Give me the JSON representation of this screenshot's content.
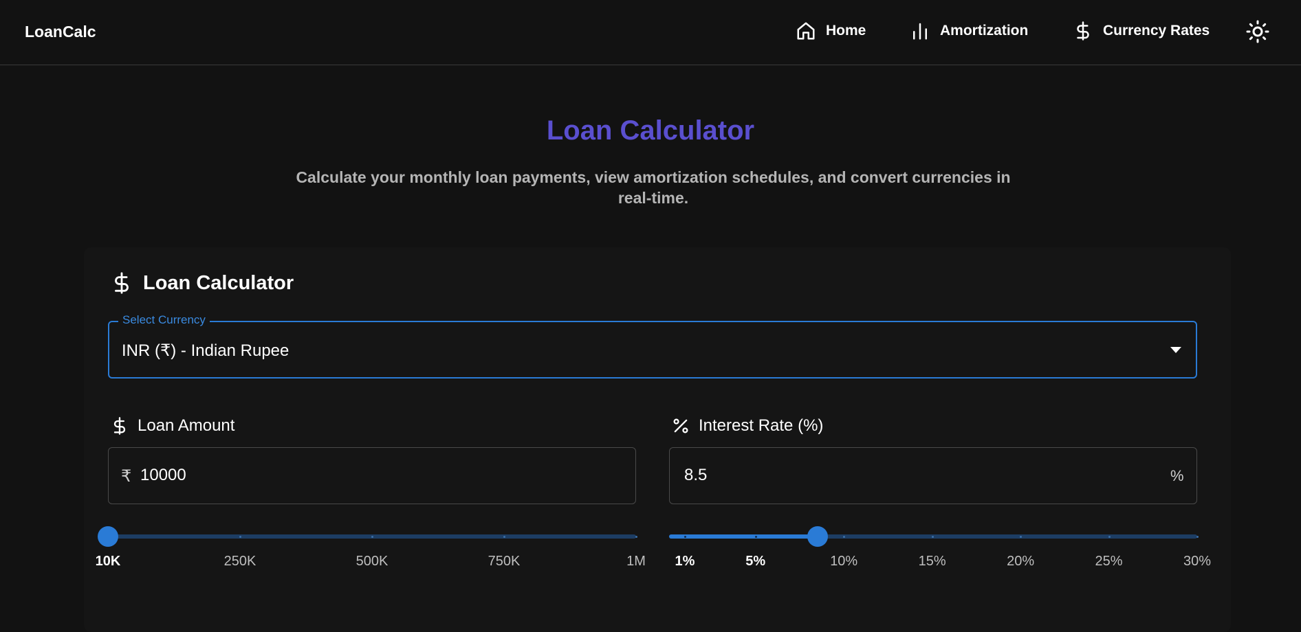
{
  "app": {
    "brand": "LoanCalc"
  },
  "nav": {
    "items": [
      {
        "label": "Home",
        "icon": "home-icon"
      },
      {
        "label": "Amortization",
        "icon": "bar-chart-icon"
      },
      {
        "label": "Currency Rates",
        "icon": "dollar-icon"
      }
    ],
    "theme_icon": "sun-icon"
  },
  "hero": {
    "title": "Loan Calculator",
    "subtitle_line1": "Calculate your monthly loan payments, view amortization schedules, and convert currencies in",
    "subtitle_line2": "real-time."
  },
  "card": {
    "title": "Loan Calculator",
    "title_icon": "dollar-icon",
    "currency": {
      "label": "Select Currency",
      "value": "INR (₹) - Indian Rupee"
    },
    "loan_amount": {
      "label": "Loan Amount",
      "prefix": "₹",
      "value": "10000",
      "slider": {
        "min": 10000,
        "max": 1000000,
        "value": 10000,
        "marks": [
          "10K",
          "250K",
          "500K",
          "750K",
          "1M"
        ],
        "active_marks": [
          "10K"
        ]
      }
    },
    "interest_rate": {
      "label": "Interest Rate (%)",
      "value": "8.5",
      "suffix": "%",
      "slider": {
        "min": 1,
        "max": 30,
        "value": 8.5,
        "marks": [
          "1%",
          "5%",
          "10%",
          "15%",
          "20%",
          "25%",
          "30%"
        ],
        "mark_values": [
          1,
          5,
          10,
          15,
          20,
          25,
          30
        ],
        "active_marks": [
          "1%",
          "5%"
        ]
      }
    }
  },
  "colors": {
    "accent": "#2a7bd6",
    "title": "#5a4fcf",
    "background": "#121212"
  }
}
